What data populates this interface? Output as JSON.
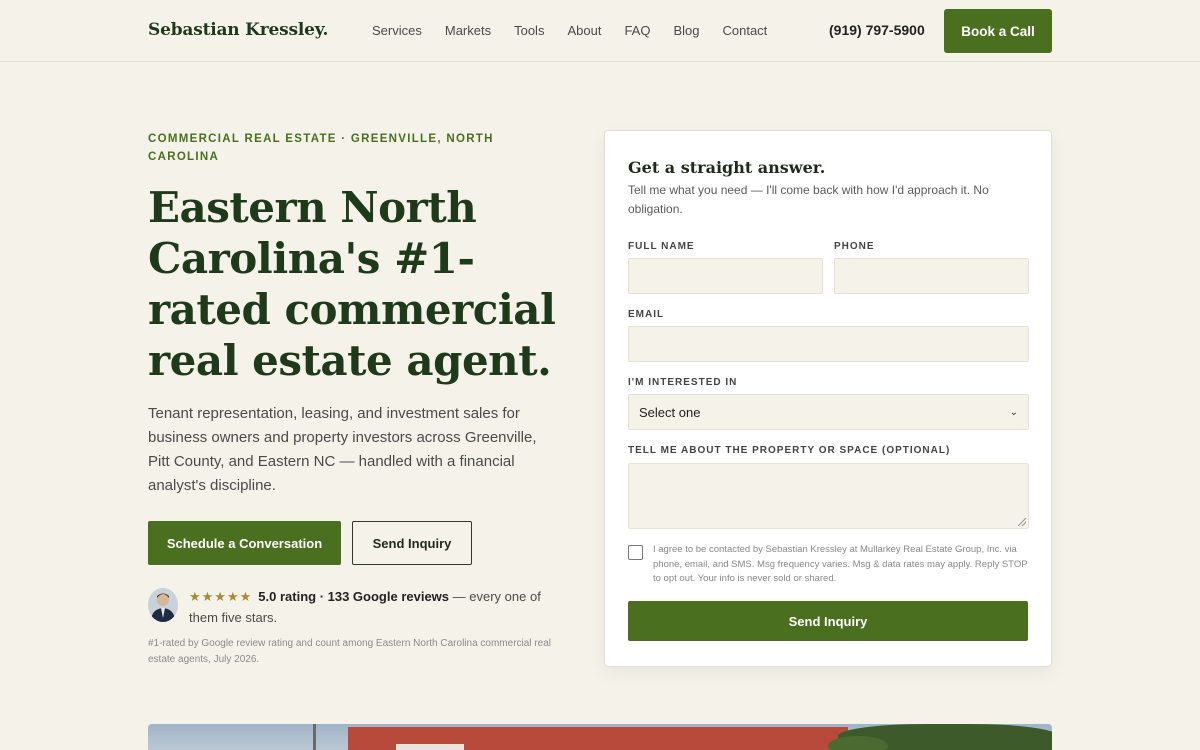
{
  "header": {
    "brand": "Sebastian Kressley.",
    "nav": [
      "Services",
      "Markets",
      "Tools",
      "About",
      "FAQ",
      "Blog",
      "Contact"
    ],
    "phone": "(919) 797-5900",
    "cta": "Book a Call"
  },
  "hero": {
    "eyebrow": "COMMERCIAL REAL ESTATE · GREENVILLE, NORTH CAROLINA",
    "title": "Eastern North Carolina's #1-rated commercial real estate agent.",
    "description": "Tenant representation, leasing, and investment sales for business owners and property investors across Greenville, Pitt County, and Eastern NC — handled with a financial analyst's discipline.",
    "primary_cta": "Schedule a Conversation",
    "secondary_cta": "Send Inquiry",
    "stars": "★★★★★",
    "rating": "5.0 rating · 133 Google reviews",
    "rating_suffix": " — every one of them five stars.",
    "footnote": "#1-rated by Google review rating and count among Eastern North Carolina commercial real estate agents, July 2026."
  },
  "form": {
    "title": "Get a straight answer.",
    "subtitle": "Tell me what you need — I'll come back with how I'd approach it. No obligation.",
    "full_name_label": "FULL NAME",
    "phone_label": "PHONE",
    "email_label": "EMAIL",
    "interest_label": "I'M INTERESTED IN",
    "interest_value": "Select one",
    "message_label": "TELL ME ABOUT THE PROPERTY OR SPACE (OPTIONAL)",
    "consent": "I agree to be contacted by Sebastian Kressley at Mullarkey Real Estate Group, Inc. via phone, email, and SMS. Msg frequency varies. Msg & data rates may apply. Reply STOP to opt out. Your info is never sold or shared.",
    "submit": "Send Inquiry"
  },
  "colors": {
    "accent": "#4a6f1e",
    "heading": "#1f3a1a",
    "background": "#f5f2ea",
    "star": "#a88a32"
  }
}
